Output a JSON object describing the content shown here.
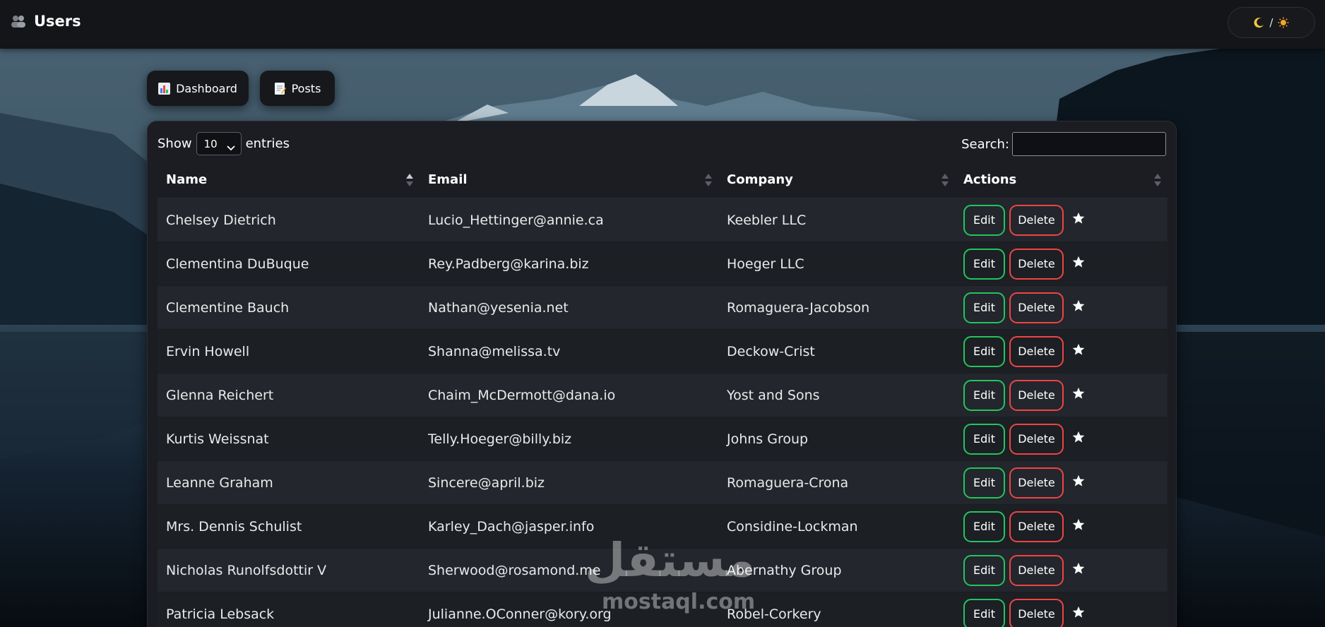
{
  "app": {
    "title": "Users",
    "theme_toggle": {
      "separator": "/",
      "moon_icon": "moon-icon",
      "sun_icon": "sun-icon"
    }
  },
  "nav": [
    {
      "label": "Dashboard",
      "icon": "bar-chart-icon"
    },
    {
      "label": "Posts",
      "icon": "memo-icon"
    }
  ],
  "table_controls": {
    "show_label": "Show",
    "entries_label": "entries",
    "page_length": "10",
    "search_label": "Search:",
    "search_value": ""
  },
  "table": {
    "columns": [
      "Name",
      "Email",
      "Company",
      "Actions"
    ],
    "edit_label": "Edit",
    "delete_label": "Delete",
    "rows": [
      {
        "name": "Chelsey Dietrich",
        "email": "Lucio_Hettinger@annie.ca",
        "company": "Keebler LLC"
      },
      {
        "name": "Clementina DuBuque",
        "email": "Rey.Padberg@karina.biz",
        "company": "Hoeger LLC"
      },
      {
        "name": "Clementine Bauch",
        "email": "Nathan@yesenia.net",
        "company": "Romaguera-Jacobson"
      },
      {
        "name": "Ervin Howell",
        "email": "Shanna@melissa.tv",
        "company": "Deckow-Crist"
      },
      {
        "name": "Glenna Reichert",
        "email": "Chaim_McDermott@dana.io",
        "company": "Yost and Sons"
      },
      {
        "name": "Kurtis Weissnat",
        "email": "Telly.Hoeger@billy.biz",
        "company": "Johns Group"
      },
      {
        "name": "Leanne Graham",
        "email": "Sincere@april.biz",
        "company": "Romaguera-Crona"
      },
      {
        "name": "Mrs. Dennis Schulist",
        "email": "Karley_Dach@jasper.info",
        "company": "Considine-Lockman"
      },
      {
        "name": "Nicholas Runolfsdottir V",
        "email": "Sherwood@rosamond.me",
        "company": "Abernathy Group"
      },
      {
        "name": "Patricia Lebsack",
        "email": "Julianne.OConner@kory.org",
        "company": "Robel-Corkery"
      }
    ]
  },
  "watermark": {
    "arabic": "مستقل",
    "latin": "mostaql.com"
  },
  "colors": {
    "edit_border": "#22c55e",
    "delete_border": "#ef4444",
    "topbar_bg": "#141518",
    "panel_bg": "#1b1d22"
  }
}
